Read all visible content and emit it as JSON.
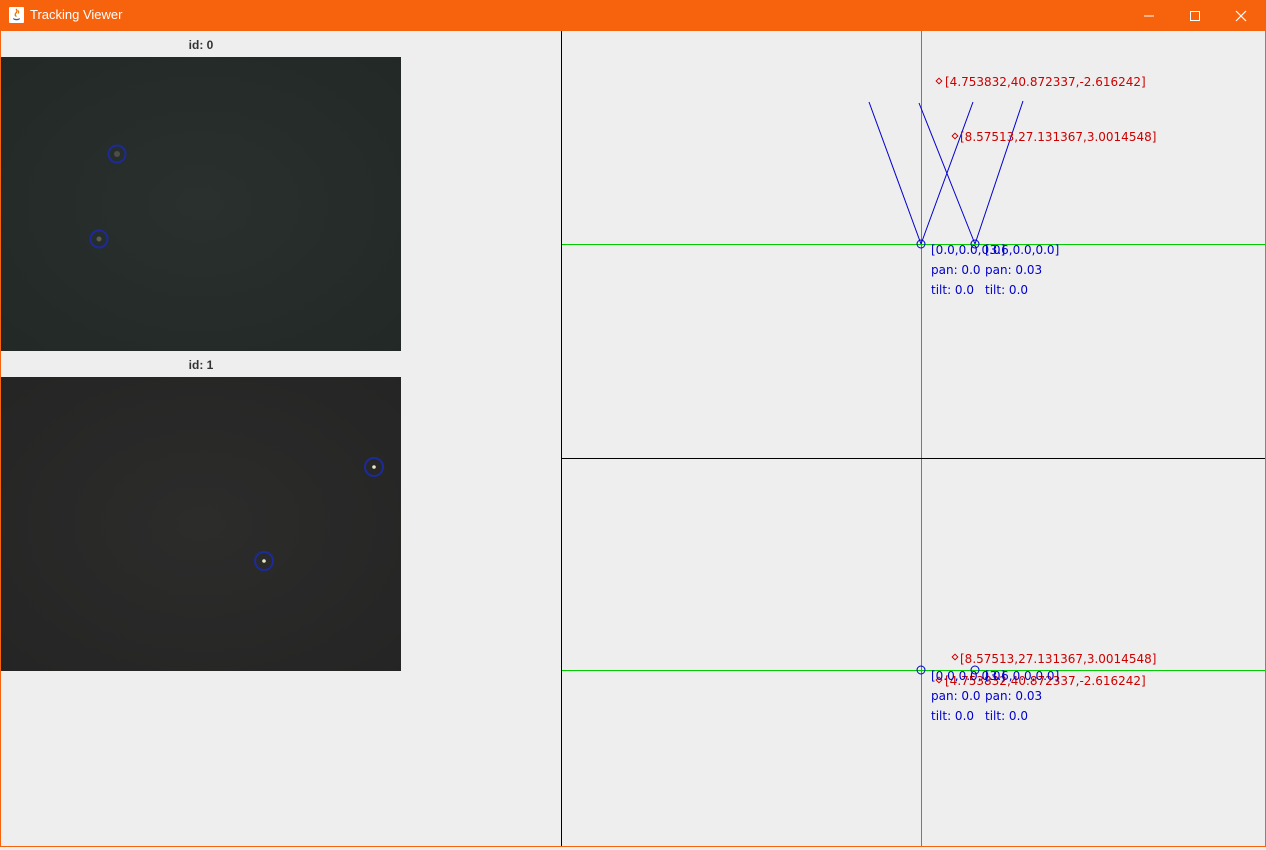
{
  "window": {
    "title": "Tracking Viewer",
    "title_bar_color": "#f7630c",
    "controls": [
      "minimize-icon",
      "maximize-icon",
      "close-icon"
    ]
  },
  "cameras": [
    {
      "label": "id: 0"
    },
    {
      "label": "id: 1"
    }
  ],
  "top_view": {
    "points": [
      {
        "label": "[4.753832,40.872337,-2.616242]"
      },
      {
        "label": "[8.57513,27.131367,3.0014548]"
      }
    ],
    "camera_a": {
      "position": "[0.0,0.0,0.0]",
      "pan": "pan: 0.0",
      "tilt": "tilt: 0.0"
    },
    "camera_b": {
      "position": "[3.6,0.0,0.0]",
      "pan": "pan: 0.03",
      "tilt": "tilt: 0.0"
    }
  },
  "bottom_view": {
    "points": [
      {
        "label": "[8.57513,27.131367,3.0014548]"
      },
      {
        "label": "[4.753832,40.872337,-2.616242]"
      }
    ],
    "camera_a": {
      "position": "[0.0,0.0,0.0]",
      "pan": "pan: 0.0",
      "tilt": "tilt: 0.0"
    },
    "camera_b": {
      "position": "[3.6,0.0,0.0]",
      "pan": "pan: 0.03",
      "tilt": "tilt: 0.0"
    }
  },
  "colors": {
    "point_label": "#cc0000",
    "camera_label": "#0000cc",
    "axis": "#00cc00",
    "detection_ring": "#1c2a9a"
  }
}
